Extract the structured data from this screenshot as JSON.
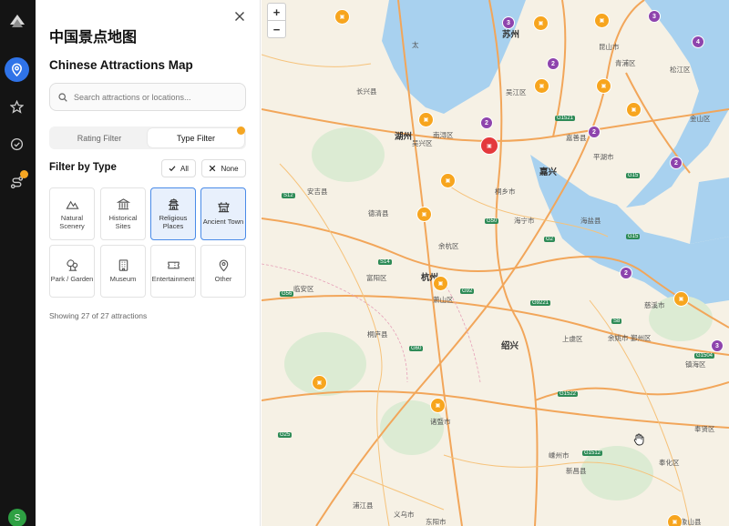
{
  "app": {
    "title_cn": "中国景点地图",
    "title_en": "Chinese Attractions Map"
  },
  "rail": {
    "items": [
      {
        "name": "map",
        "icon": "map-pin-icon",
        "active": true
      },
      {
        "name": "favorites",
        "icon": "star-icon"
      },
      {
        "name": "visited",
        "icon": "check-circle-icon"
      },
      {
        "name": "routes",
        "icon": "route-icon",
        "badge": true
      }
    ],
    "avatar_initial": "S"
  },
  "search": {
    "placeholder": "Search attractions or locations..."
  },
  "tabs": {
    "rating": "Rating Filter",
    "type": "Type Filter",
    "active": "type"
  },
  "filter": {
    "heading": "Filter by Type",
    "all_label": "All",
    "none_label": "None",
    "types": [
      {
        "label": "Natural Scenery",
        "icon": "mountain-icon",
        "selected": false
      },
      {
        "label": "Historical Sites",
        "icon": "columns-icon",
        "selected": false
      },
      {
        "label": "Religious Places",
        "icon": "temple-icon",
        "selected": true
      },
      {
        "label": "Ancient Town",
        "icon": "pagoda-icon",
        "selected": true
      },
      {
        "label": "Park / Garden",
        "icon": "trees-icon",
        "selected": false
      },
      {
        "label": "Museum",
        "icon": "building-icon",
        "selected": false
      },
      {
        "label": "Entertainment",
        "icon": "ticket-icon",
        "selected": false
      },
      {
        "label": "Other",
        "icon": "location-icon",
        "selected": false
      }
    ],
    "showing_text": "Showing 27 of 27 attractions"
  },
  "map": {
    "zoom_in": "+",
    "zoom_out": "−",
    "labels": {
      "tai": "太",
      "suzhou": "苏州",
      "huzhou": "湖州",
      "jiaxing": "嘉兴",
      "hangzhou": "杭州",
      "shaoxing": "绍兴",
      "changxing": "长兴县",
      "anji": "安吉县",
      "deqing": "德清县",
      "yuhang": "余杭区",
      "linan": "临安区",
      "fuyang": "富阳区",
      "xiaoshan": "萧山区",
      "haining": "海宁市",
      "tongxiang": "桐乡市",
      "pinghu": "平湖市",
      "haiyan": "海盐县",
      "jiashan": "嘉善县",
      "wujiang": "吴江区",
      "kunshan": "昆山市",
      "qingpu": "青浦区",
      "songjiang": "松江区",
      "jinshan": "金山区",
      "fengxian": "奉贤区",
      "cixi": "慈溪市",
      "yuyao": "余姚市",
      "shangyu": "上虞区",
      "zhuji": "诸暨市",
      "tonglu": "桐庐县",
      "pujiang": "浦江县",
      "yiwu": "义乌市",
      "dongyang": "东阳市",
      "shengzhou": "嵊州市",
      "xinchang": "新昌县",
      "fenghua": "奉化区",
      "nanxun": "南浔区",
      "wuxing": "吴兴区",
      "yinzhou": "鄞州区",
      "zhenhai": "镇海区",
      "xiangshan": "象山县"
    },
    "highways": [
      "G50",
      "G60",
      "G92",
      "G15",
      "G1521",
      "G2",
      "G25",
      "G56",
      "G9221",
      "G1522",
      "G1512",
      "G1504",
      "G15",
      "S12",
      "S14",
      "S8"
    ],
    "clusters": [
      "3",
      "4",
      "2",
      "2",
      "2",
      "2",
      "2",
      "3",
      "2"
    ]
  }
}
